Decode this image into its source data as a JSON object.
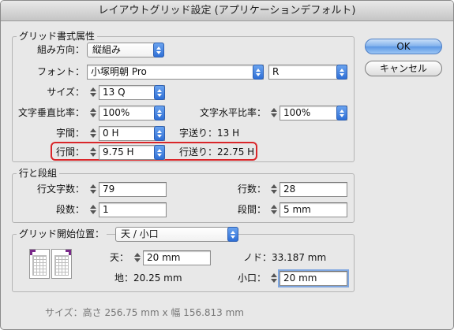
{
  "window": {
    "title": "レイアウトグリッド設定 (アプリケーションデフォルト)"
  },
  "buttons": {
    "ok": "OK",
    "cancel": "キャンセル"
  },
  "grid_format": {
    "legend": "グリッド書式属性",
    "direction_label": "組み方向：",
    "direction_value": "縦組み",
    "font_label": "フォント：",
    "font_family": "小塚明朝 Pro",
    "font_style": "R",
    "size_label": "サイズ：",
    "size_value": "13 Q",
    "vscale_label": "文字垂直比率：",
    "vscale_value": "100%",
    "hscale_label": "文字水平比率：",
    "hscale_value": "100%",
    "char_space_label": "字間：",
    "char_space_value": "0 H",
    "char_feed_text": "字送り：13 H",
    "line_space_label": "行間：",
    "line_space_value": "9.75 H",
    "line_feed_text": "行送り：22.75 H"
  },
  "lines_columns": {
    "legend": "行と段組",
    "chars_per_line_label": "行文字数：",
    "chars_per_line_value": "79",
    "lines_label": "行数：",
    "lines_value": "28",
    "columns_label": "段数：",
    "columns_value": "1",
    "gutter_label": "段間：",
    "gutter_value": "5 mm"
  },
  "grid_start": {
    "legend": "グリッド開始位置：",
    "position_value": "天 / 小口",
    "top_label": "天：",
    "top_value": "20 mm",
    "nodo_text": "ノド：33.187 mm",
    "bottom_text": "地：20.25 mm",
    "fore_edge_label": "小口：",
    "fore_edge_value": "20 mm"
  },
  "footer": {
    "size_text": "サイズ：高さ 256.75 mm x 幅 156.813 mm"
  },
  "colors": {
    "highlight": "#d9262a",
    "accent_blue": "#2f6fd6"
  }
}
